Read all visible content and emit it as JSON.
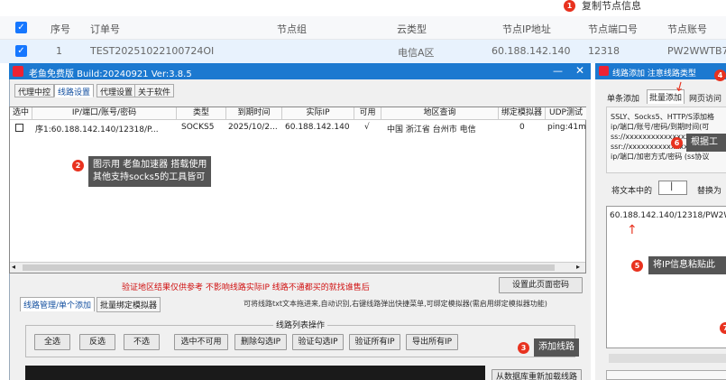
{
  "bg_table": {
    "headers": [
      "序号",
      "订单号",
      "节点组",
      "云类型",
      "节点IP地址",
      "节点端口号",
      "节点账号"
    ],
    "row": [
      "1",
      "TEST20251022100724OI",
      "",
      "电信A区",
      "60.188.142.140",
      "12318",
      "PW2WWTB7"
    ]
  },
  "main_window": {
    "title": "老鱼免费版 Build:20240921 Ver:3.8.5",
    "tabs": [
      "代理中控",
      "线路设置",
      "代理设置",
      "关于软件"
    ],
    "grid_headers": [
      "选中",
      "IP/端口/账号/密码",
      "类型",
      "到期时间",
      "实际IP",
      "可用",
      "地区查询",
      "绑定模拟器",
      "UDP测试"
    ],
    "grid_row": [
      "",
      "序1:60.188.142.140/12318/P...",
      "SOCKS5",
      "2025/10/2...",
      "60.188.142.140",
      "√",
      "中国 浙江省 台州市 电信",
      "0",
      "ping:41m"
    ],
    "note": "验证地区结果仅供参考 不影响线路实际IP 线路不通都买的就找谁售后",
    "set_password_btn": "设置此页面密码",
    "sub_tabs": [
      "线路管理/单个添加",
      "批量绑定模拟器"
    ],
    "drag_hint": "可将线路txt文本拖进来,自动识别,右键线路弹出快捷菜单,可绑定模拟器(需启用绑定模拟器功能)",
    "ops_title": "线路列表操作",
    "ops_buttons": [
      "全选",
      "反选",
      "不选",
      "选中不可用",
      "删除勾选IP",
      "验证勾选IP",
      "验证所有IP",
      "导出所有IP"
    ],
    "bottom_btn": "从数据库重新加载线路"
  },
  "right_window": {
    "title": "线路添加 注意线路类型",
    "tabs": [
      "单条添加",
      "批量添加",
      "网页访问"
    ],
    "hint_lines": [
      "SSLY、Socks5、HTTP/S添加格",
      "ip/端口/账号/密码/到期时间(可",
      "ss://xxxxxxxxxxxxxxxx",
      "ssr://xxxxxxxxxxxxxxxx",
      "ip/端口/加密方式/密码 (ss协议"
    ],
    "replace_label": "将文本中的",
    "replace_value": "|",
    "replace_with": "替换为",
    "paste_text": "60.188.142.140/12318/PW2W"
  },
  "annotations": {
    "a1": {
      "num": "1",
      "text": "复制节点信息"
    },
    "a2": {
      "num": "2",
      "text": "图示用 老鱼加速器 搭载使用\n其他支持socks5的工具皆可"
    },
    "a3": {
      "num": "3",
      "text": "添加线路"
    },
    "a4": {
      "num": "4"
    },
    "a5": {
      "num": "5",
      "text": "将IP信息粘贴此"
    },
    "a6": {
      "num": "6",
      "text": "根据工"
    },
    "a7": {
      "num": "7"
    }
  },
  "colors": {
    "title_bar": "#1c79d0",
    "badge": "#e8321f",
    "tip_bg": "#555555",
    "selected_row": "#e8f2fd"
  }
}
